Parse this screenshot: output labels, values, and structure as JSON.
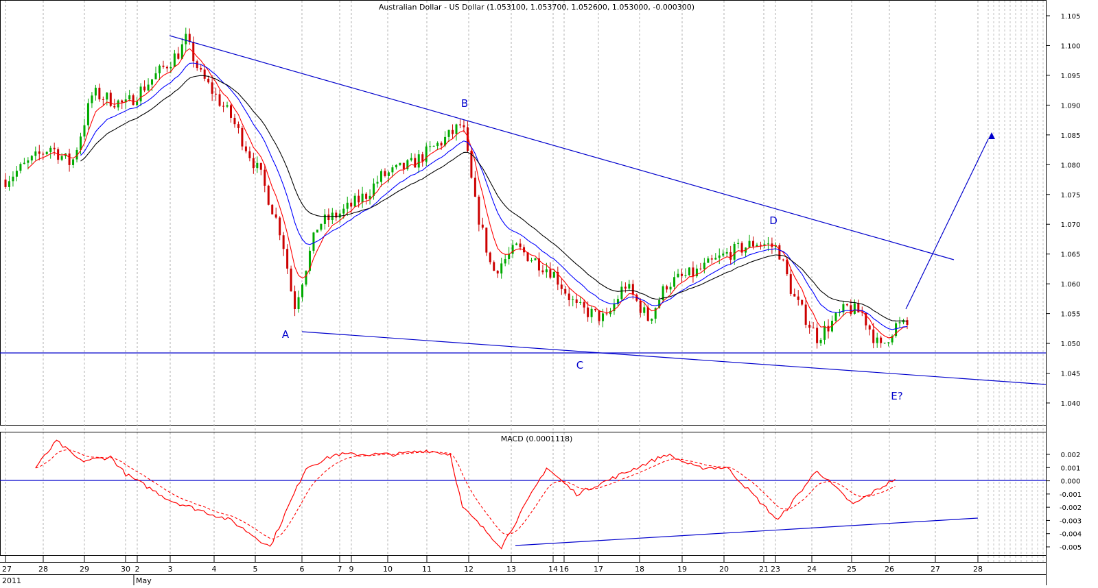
{
  "chart_data": [
    {
      "type": "candlestick",
      "title": "Australian Dollar - US Dollar (1.053100, 1.053700, 1.052600, 1.053000, -0.000300)",
      "ylim": [
        1.038,
        1.106
      ],
      "y_ticks": [
        "1.105",
        "1.100",
        "1.095",
        "1.090",
        "1.085",
        "1.080",
        "1.075",
        "1.070",
        "1.065",
        "1.060",
        "1.055",
        "1.050",
        "1.045",
        "1.040"
      ],
      "y_tick_values": [
        1.105,
        1.1,
        1.095,
        1.09,
        1.085,
        1.08,
        1.075,
        1.07,
        1.065,
        1.06,
        1.055,
        1.05,
        1.045,
        1.04
      ],
      "x_ticks": [
        "27",
        "28",
        "29",
        "30",
        "2",
        "3",
        "4",
        "5",
        "6",
        "7",
        "9",
        "10",
        "11",
        "12",
        "13",
        "14",
        "16",
        "17",
        "18",
        "19",
        "20",
        "21",
        "23",
        "24",
        "25",
        "26",
        "27",
        "28"
      ],
      "x_ticks_extra": [
        "2011",
        "May"
      ],
      "wave_labels": [
        "A",
        "B",
        "C",
        "D",
        "E?"
      ],
      "price_path": [
        [
          0,
          1.0775
        ],
        [
          1.5,
          1.083
        ],
        [
          2.2,
          1.08
        ],
        [
          2.9,
          1.092
        ],
        [
          4,
          1.09
        ],
        [
          5,
          1.095
        ],
        [
          5.8,
          1.099
        ],
        [
          6,
          1.101
        ],
        [
          6.5,
          1.095
        ],
        [
          7.5,
          1.088
        ],
        [
          8.5,
          1.078
        ],
        [
          9.2,
          1.068
        ],
        [
          9.6,
          1.056
        ],
        [
          10.4,
          1.07
        ],
        [
          11.2,
          1.072
        ],
        [
          12,
          1.075
        ],
        [
          12.5,
          1.078
        ],
        [
          13.5,
          1.08
        ],
        [
          14.8,
          1.085
        ],
        [
          15.2,
          1.087
        ],
        [
          15.6,
          1.074
        ],
        [
          16.2,
          1.062
        ],
        [
          17,
          1.066
        ],
        [
          18.2,
          1.062
        ],
        [
          19,
          1.056
        ],
        [
          20,
          1.054
        ],
        [
          20.6,
          1.06
        ],
        [
          21.4,
          1.054
        ],
        [
          22,
          1.06
        ],
        [
          23,
          1.062
        ],
        [
          24,
          1.065
        ],
        [
          25,
          1.067
        ],
        [
          25.7,
          1.066
        ],
        [
          26.2,
          1.058
        ],
        [
          27,
          1.051
        ],
        [
          28,
          1.056
        ],
        [
          28.5,
          1.055
        ],
        [
          29.1,
          1.049
        ],
        [
          29.6,
          1.053
        ],
        [
          30,
          1.053
        ]
      ],
      "moving_average_colors": [
        "#ff0000",
        "#0000ff",
        "#000000"
      ],
      "up_candle_color": "#00aa00",
      "down_candle_color": "#cc0000"
    },
    {
      "type": "line",
      "title": "MACD (0.0001118)",
      "ylim": [
        -0.0055,
        0.0033
      ],
      "y_ticks": [
        "0.002",
        "0.001",
        "0.000",
        "-0.001",
        "-0.002",
        "-0.003",
        "-0.004",
        "-0.005"
      ],
      "y_tick_values": [
        0.002,
        0.001,
        0.0,
        -0.001,
        -0.002,
        -0.003,
        -0.004,
        -0.005
      ],
      "macd_path": [
        [
          1,
          0.001
        ],
        [
          1.7,
          0.003
        ],
        [
          2.5,
          0.0015
        ],
        [
          3.5,
          0.0018
        ],
        [
          4,
          0.0005
        ],
        [
          5.5,
          -0.0015
        ],
        [
          7.5,
          -0.003
        ],
        [
          8.8,
          -0.005
        ],
        [
          10,
          0.001
        ],
        [
          11,
          0.002
        ],
        [
          13,
          0.002
        ],
        [
          14,
          0.0023
        ],
        [
          14.8,
          0.002
        ],
        [
          15.2,
          -0.002
        ],
        [
          16.5,
          -0.005
        ],
        [
          18,
          0.001
        ],
        [
          19,
          -0.001
        ],
        [
          20,
          0.0
        ],
        [
          22,
          0.002
        ],
        [
          23,
          0.001
        ],
        [
          24,
          0.001
        ],
        [
          25.7,
          -0.003
        ],
        [
          27,
          0.0008
        ],
        [
          28.2,
          -0.0018
        ],
        [
          29.7,
          0.0003
        ]
      ],
      "line_color": "#ff0000"
    }
  ]
}
